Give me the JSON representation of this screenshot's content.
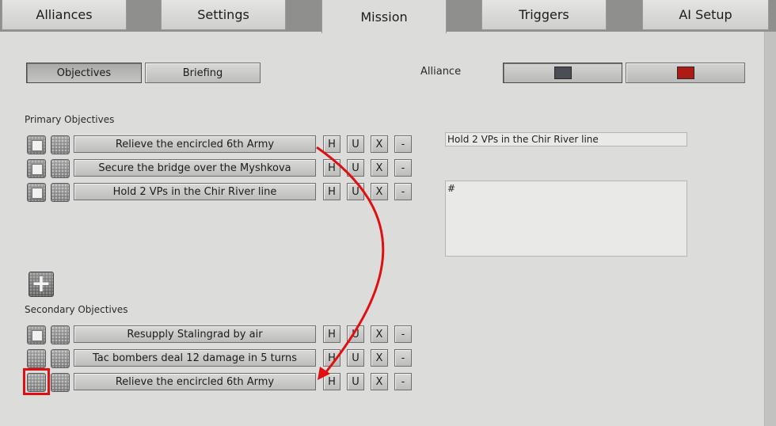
{
  "tabs": [
    "Alliances",
    "Settings",
    "Mission",
    "Triggers",
    "AI Setup"
  ],
  "active_tab": "Mission",
  "mode_buttons": {
    "objectives": "Objectives",
    "briefing": "Briefing"
  },
  "alliance": {
    "label": "Alliance",
    "swatches": [
      {
        "color": "#4a4d54",
        "selected": true
      },
      {
        "color": "#b01a14",
        "selected": false
      }
    ]
  },
  "primary": {
    "label": "Primary Objectives",
    "items": [
      {
        "text": "Relieve the encircled 6th Army"
      },
      {
        "text": "Secure the bridge over the Myshkova"
      },
      {
        "text": "Hold 2 VPs in the Chir River line"
      }
    ]
  },
  "secondary": {
    "label": "Secondary Objectives",
    "items": [
      {
        "text": "Resupply Stalingrad by air"
      },
      {
        "text": "Tac bombers deal 12 damage in 5 turns"
      },
      {
        "text": "Relieve the encircled 6th Army"
      }
    ]
  },
  "row_buttons": {
    "h": "H",
    "u": "U",
    "x": "X",
    "remove": "-"
  },
  "add_button": "+",
  "detail": {
    "title": "Hold 2 VPs in the Chir River line",
    "description": "#"
  },
  "annotation_colors": {
    "arrow": "#e01010",
    "highlight": "#e01010"
  }
}
